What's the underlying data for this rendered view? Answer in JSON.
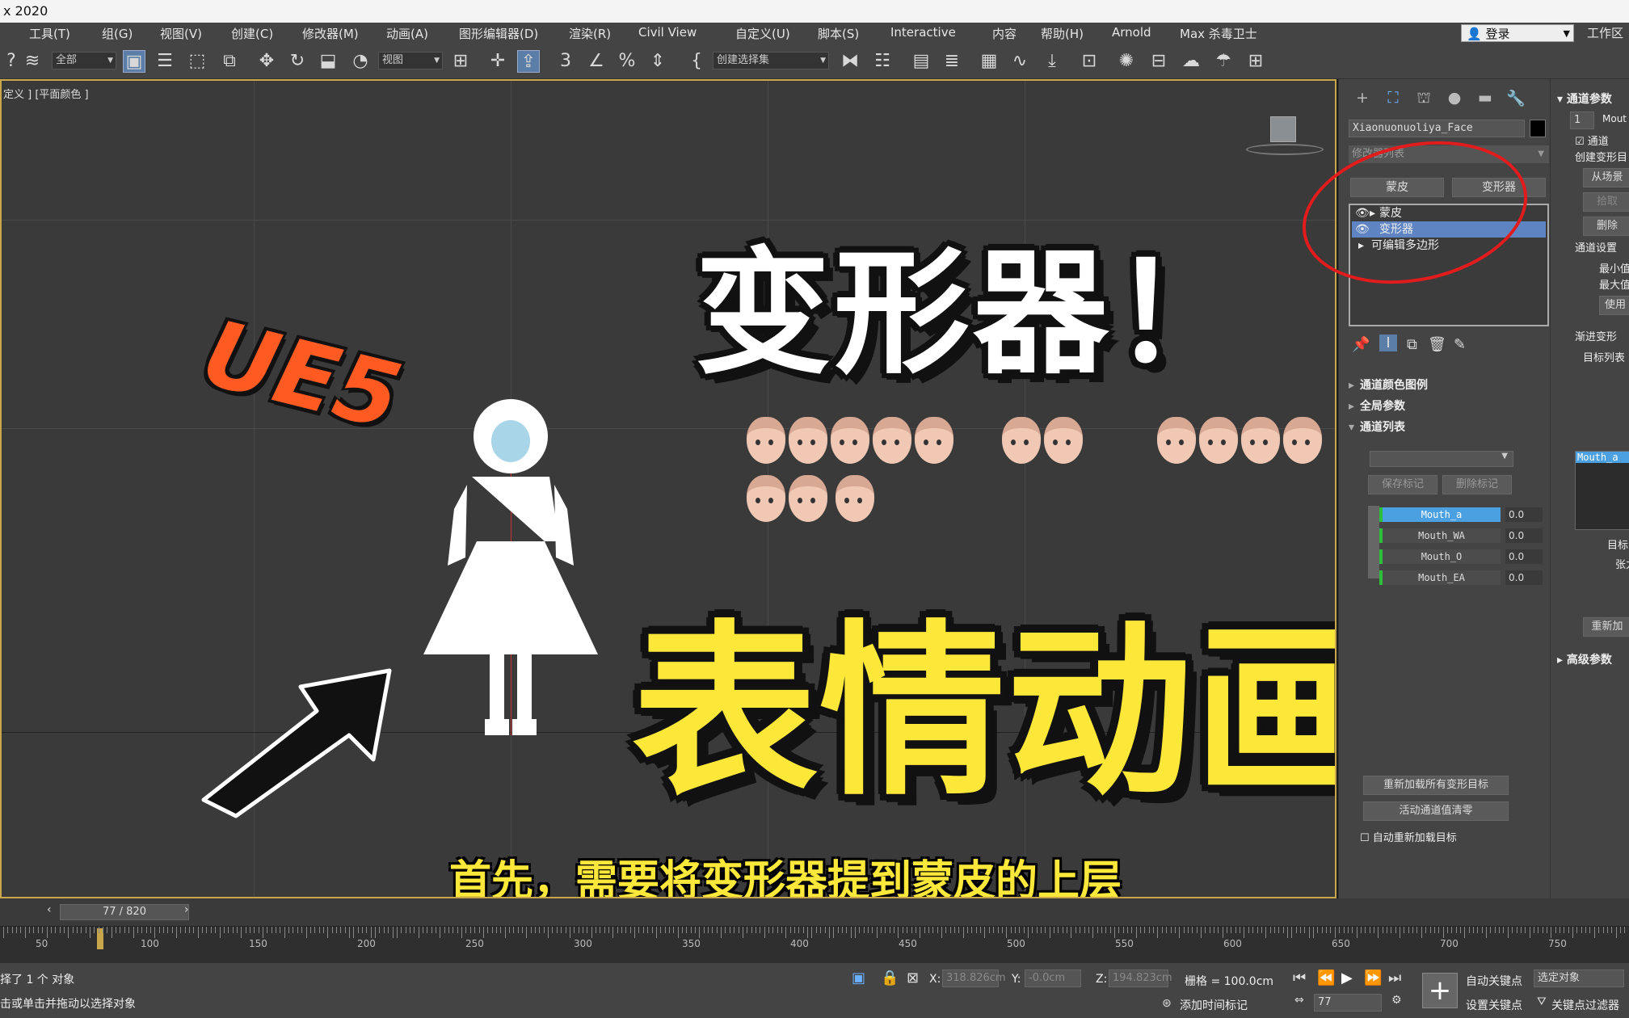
{
  "window": {
    "title": "x 2020"
  },
  "menu": {
    "items": [
      "工具(T)",
      "组(G)",
      "视图(V)",
      "创建(C)",
      "修改器(M)",
      "动画(A)",
      "图形编辑器(D)",
      "渲染(R)",
      "Civil View",
      "自定义(U)",
      "脚本(S)",
      "Interactive",
      "内容",
      "帮助(H)",
      "Arnold",
      "Max 杀毒卫士"
    ],
    "login": "登录",
    "workspace": "工作区"
  },
  "toolbar": {
    "filter": "全部",
    "ref_coord": "视图",
    "selection_set": "创建选择集"
  },
  "viewport": {
    "label": "定义 ] [平面颜色 ]",
    "overlay_ue5": "UE5",
    "overlay_title": "变形器！",
    "overlay_main": "表情动画",
    "subtitle": "首先，需要将变形器提到蒙皮的上层"
  },
  "command_panel": {
    "object_name": "Xiaonuonuoliya_Face",
    "modifier_list": "修改器列表",
    "btn_skin": "蒙皮",
    "btn_morpher": "变形器",
    "stack": [
      "蒙皮",
      "变形器",
      "可编辑多边形"
    ],
    "sections": [
      "通道颜色图例",
      "全局参数",
      "通道列表"
    ],
    "save_marker": "保存标记",
    "delete_marker": "删除标记",
    "channels": [
      {
        "name": "Mouth_a",
        "value": "0.0"
      },
      {
        "name": "Mouth_WA",
        "value": "0.0"
      },
      {
        "name": "Mouth_O",
        "value": "0.0"
      },
      {
        "name": "Mouth_EA",
        "value": "0.0"
      }
    ],
    "reload_all": "重新加载所有变形目标",
    "zero_active": "活动通道值清零",
    "auto_reload": "自动重新加载目标"
  },
  "channel_params": {
    "title": "通道参数",
    "index": "1",
    "name_short": "Mout",
    "check_label": "通道",
    "create_target": "创建变形目",
    "from_scene": "从场景",
    "pick": "拾取",
    "delete": "删除",
    "channel_settings": "通道设置",
    "min": "最小值",
    "max": "最大值",
    "use": "使用",
    "progressive": "渐进变形",
    "target_list": "目标列表",
    "target_item": "Mouth_a",
    "target": "目标",
    "tension": "张力",
    "reorder": "重新加",
    "advanced": "高级参数"
  },
  "timeline": {
    "frame": "77 / 820",
    "ruler_labels": [
      "50",
      "100",
      "150",
      "200",
      "250",
      "300",
      "350",
      "400",
      "450",
      "500",
      "550",
      "600",
      "650",
      "700",
      "750"
    ]
  },
  "status": {
    "selected": "择了 1 个 对象",
    "hint": "击或单击并拖动以选择对象",
    "x_label": "X:",
    "x_value": "318.826cm",
    "y_label": "Y:",
    "y_value": "-0.0cm",
    "z_label": "Z:",
    "z_value": "194.823cm",
    "grid": "栅格 = 100.0cm",
    "add_time_tag": "添加时间标记",
    "auto_key": "自动关键点",
    "selected_obj": "选定对象",
    "set_key": "设置关键点",
    "key_filters": "关键点过滤器",
    "frame_field": "77"
  }
}
